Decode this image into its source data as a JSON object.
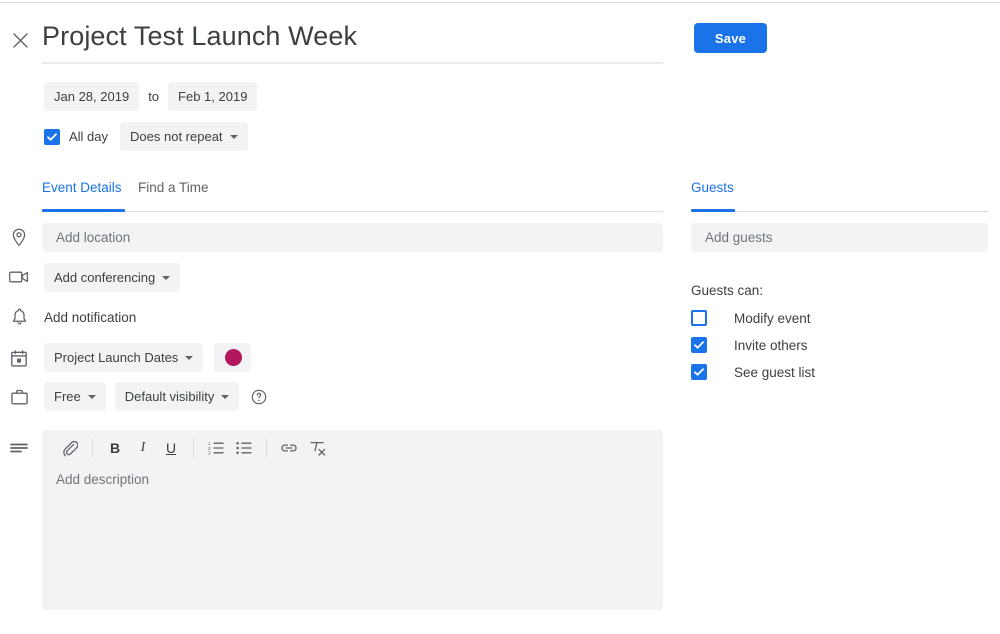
{
  "window": {
    "close_icon": "close-icon"
  },
  "header": {
    "title": "Project Test Launch Week",
    "save_label": "Save"
  },
  "schedule": {
    "start_date": "Jan 28, 2019",
    "to_label": "to",
    "end_date": "Feb 1, 2019",
    "all_day_label": "All day",
    "all_day_checked": true,
    "repeat_label": "Does not repeat"
  },
  "tabs": [
    {
      "label": "Event Details",
      "active": true
    },
    {
      "label": "Find a Time",
      "active": false
    }
  ],
  "details": {
    "location": {
      "icon": "location-pin-icon",
      "placeholder": "Add location",
      "value": ""
    },
    "conferencing": {
      "icon": "video-camera-icon",
      "label": "Add conferencing"
    },
    "notification": {
      "icon": "bell-icon",
      "label": "Add notification"
    },
    "calendar": {
      "icon": "calendar-icon",
      "label": "Project Launch Dates"
    },
    "color": {
      "label": "event-color",
      "hex": "#B3185E"
    },
    "availability": {
      "icon": "briefcase-icon",
      "label": "Free"
    },
    "visibility": {
      "label": "Default visibility"
    },
    "help": {
      "icon": "help-circle-icon"
    },
    "description": {
      "icon": "description-lines-icon",
      "placeholder": "Add description",
      "value": "",
      "toolbar": [
        {
          "name": "attach-file-icon",
          "label": ""
        },
        {
          "name": "bold-icon",
          "label": "B"
        },
        {
          "name": "italic-icon",
          "label": "I"
        },
        {
          "name": "underline-icon",
          "label": "U"
        },
        {
          "name": "numbered-list-icon",
          "label": ""
        },
        {
          "name": "bulleted-list-icon",
          "label": ""
        },
        {
          "name": "insert-link-icon",
          "label": ""
        },
        {
          "name": "clear-formatting-icon",
          "label": ""
        }
      ]
    }
  },
  "guests": {
    "tab_label": "Guests",
    "input_placeholder": "Add guests",
    "input_value": "",
    "permissions_label": "Guests can:",
    "permissions": [
      {
        "label": "Modify event",
        "checked": false
      },
      {
        "label": "Invite others",
        "checked": true
      },
      {
        "label": "See guest list",
        "checked": true
      }
    ]
  },
  "colors": {
    "accent": "#1a73e8",
    "field_bg": "#f1f3f4",
    "text": "#3c4043",
    "muted": "#5f6368",
    "placeholder": "#70757a",
    "rule": "#dadce0"
  }
}
